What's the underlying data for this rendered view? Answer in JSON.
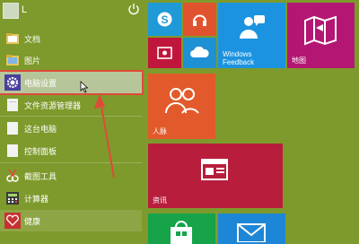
{
  "user": {
    "name": "L"
  },
  "list": {
    "items": [
      {
        "label": "文档"
      },
      {
        "label": "图片"
      },
      {
        "label": "电脑设置"
      },
      {
        "label": "文件资源管理器"
      },
      {
        "label": "这台电脑"
      },
      {
        "label": "控制面板"
      },
      {
        "label": "截图工具"
      },
      {
        "label": "计算器"
      },
      {
        "label": "健康"
      }
    ]
  },
  "tiles": {
    "weather": {
      "label1": "Windows",
      "label2": "Feedback"
    },
    "maps": {
      "label": "地图"
    },
    "people": {
      "label": "人脉"
    },
    "news": {
      "label": "资讯"
    }
  },
  "colors": {
    "background": "#7e9a2c",
    "skype": "#1f9ad6",
    "music": "#e0532f",
    "video": "#c0163b",
    "onedrive": "#1e90d4",
    "feedback": "#1c93e0",
    "maps": "#b31773",
    "people": "#e25a2b",
    "news": "#b81e3c",
    "store": "#16a34a",
    "mail": "#1e86d6",
    "highlight": "#e04a3a"
  }
}
